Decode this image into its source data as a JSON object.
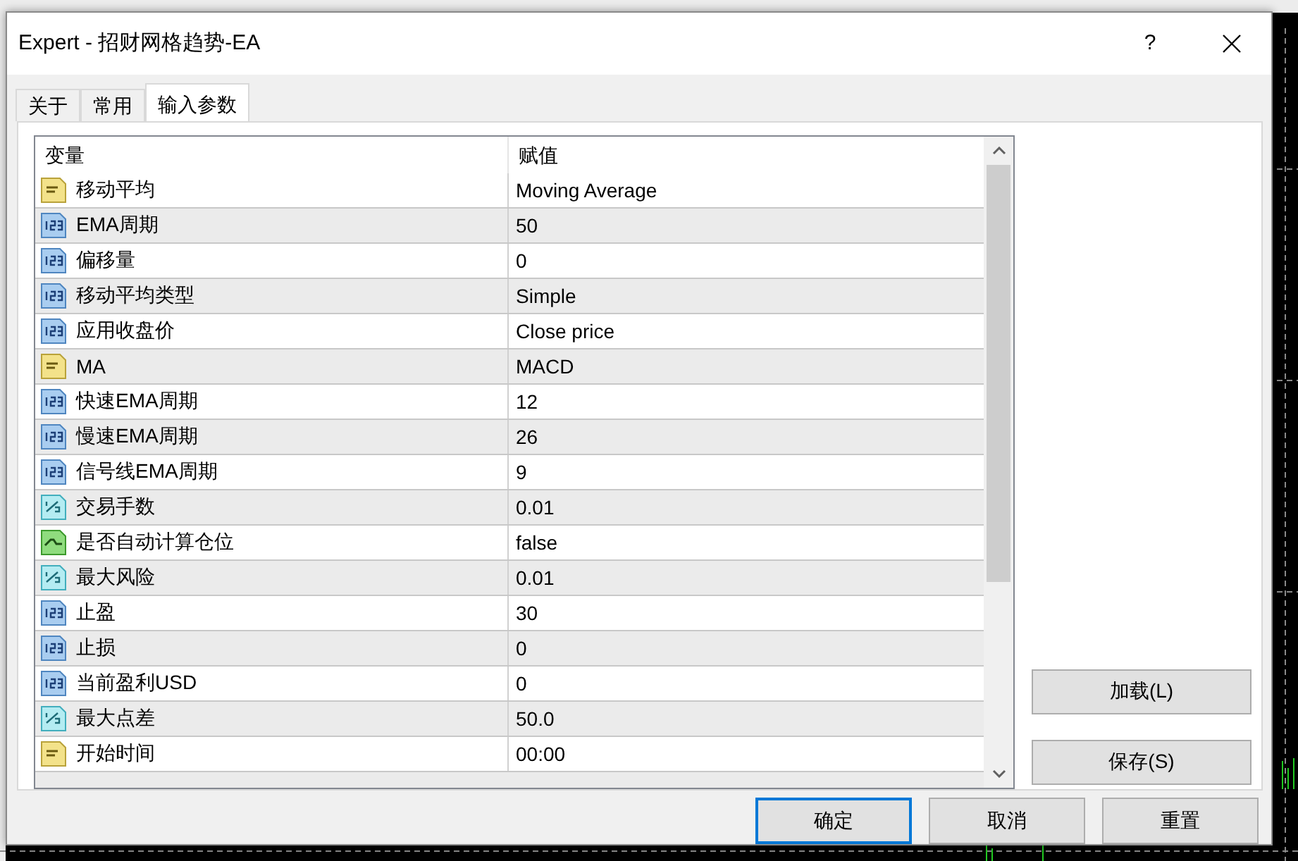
{
  "window": {
    "title": "Expert - 招财网格趋势-EA",
    "help": "?"
  },
  "tabs": [
    {
      "label": "关于",
      "selected": false
    },
    {
      "label": "常用",
      "selected": false
    },
    {
      "label": "输入参数",
      "selected": true
    }
  ],
  "table": {
    "columns": [
      "变量",
      "赋值"
    ],
    "rows": [
      {
        "kind": "string",
        "name": "移动平均",
        "value": "Moving Average"
      },
      {
        "kind": "int",
        "name": "EMA周期",
        "value": "50"
      },
      {
        "kind": "int",
        "name": "偏移量",
        "value": "0"
      },
      {
        "kind": "int",
        "name": "移动平均类型",
        "value": "Simple"
      },
      {
        "kind": "int",
        "name": "应用收盘价",
        "value": "Close price"
      },
      {
        "kind": "string",
        "name": "MA",
        "value": "MACD"
      },
      {
        "kind": "int",
        "name": "快速EMA周期",
        "value": "12"
      },
      {
        "kind": "int",
        "name": "慢速EMA周期",
        "value": "26"
      },
      {
        "kind": "int",
        "name": "信号线EMA周期",
        "value": "9"
      },
      {
        "kind": "double",
        "name": "交易手数",
        "value": "0.01"
      },
      {
        "kind": "bool",
        "name": "是否自动计算仓位",
        "value": "false"
      },
      {
        "kind": "double",
        "name": "最大风险",
        "value": "0.01"
      },
      {
        "kind": "int",
        "name": "止盈",
        "value": "30"
      },
      {
        "kind": "int",
        "name": "止损",
        "value": "0"
      },
      {
        "kind": "int",
        "name": "当前盈利USD",
        "value": "0"
      },
      {
        "kind": "double",
        "name": "最大点差",
        "value": "50.0"
      },
      {
        "kind": "string",
        "name": "开始时间",
        "value": "00:00"
      }
    ]
  },
  "side_buttons": [
    "加载(L)",
    "保存(S)"
  ],
  "footer_buttons": [
    {
      "label": "确定",
      "default": true
    },
    {
      "label": "取消",
      "default": false
    },
    {
      "label": "重置",
      "default": false
    }
  ]
}
